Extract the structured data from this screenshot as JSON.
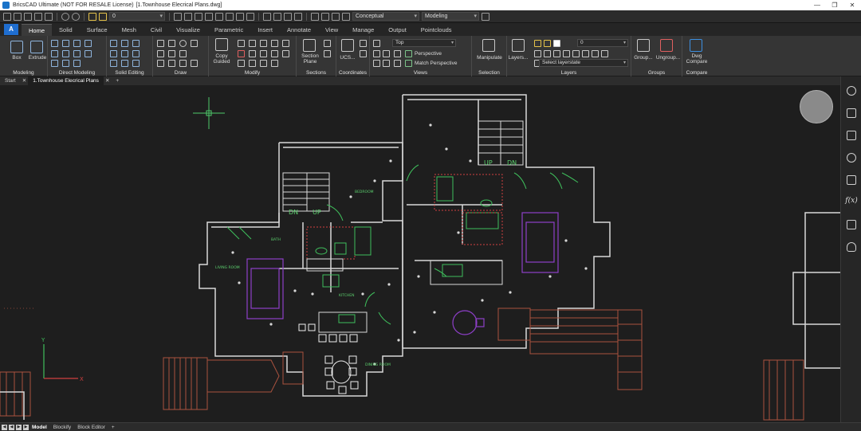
{
  "titlebar": {
    "app": "BricsCAD Ultimate (NOT FOR RESALE License)",
    "doc": "[1.Townhouse Elecrical Plans.dwg]",
    "minimize": "—",
    "restore": "❐",
    "close": "✕"
  },
  "qat": {
    "layer_value": "0",
    "visual_style": "Conceptual",
    "workspace": "Modeling"
  },
  "app_button": "A",
  "tabs": [
    "Home",
    "Solid",
    "Surface",
    "Mesh",
    "Civil",
    "Visualize",
    "Parametric",
    "Insert",
    "Annotate",
    "View",
    "Manage",
    "Output",
    "Pointclouds"
  ],
  "ribbon": {
    "box": "Box",
    "extrude": "Extrude",
    "copy_guided": "Copy Guided",
    "section_plane": "Section Plane",
    "ucs": "UCS...",
    "view_top": "Top",
    "perspective": "Perspective",
    "match_perspective": "Match Perspective",
    "manipulate": "Manipulate",
    "layers": "Layers...",
    "layer_current": "0",
    "layerstate": "Select layerstate",
    "group": "Group...",
    "ungroup": "Ungroup...",
    "dwg_compare": "Dwg Compare",
    "panels": {
      "modeling": "Modeling",
      "direct_modeling": "Direct Modeling",
      "solid_editing": "Solid Editing",
      "draw": "Draw",
      "modify": "Modify",
      "sections": "Sections",
      "coordinates": "Coordinates",
      "views": "Views",
      "selection": "Selection",
      "layers": "Layers",
      "groups": "Groups",
      "compare": "Compare"
    }
  },
  "doc_tabs": {
    "start": "Start",
    "close1": "✕",
    "active": "1.Townhouse Elecrical Plans",
    "close2": "✕",
    "add": "+"
  },
  "drawing": {
    "rooms": {
      "bedroom": "BEDROOM",
      "family_room": "LIVING ROOM",
      "kitchen": "KITCHEN",
      "dining": "DINING ROOM",
      "bath": "BATH"
    },
    "dn1": "DN",
    "up1": "UP",
    "dn2": "DN",
    "up2": "UP",
    "axis_y": "Y",
    "axis_x": "X"
  },
  "status": {
    "model": "Model",
    "blockify": "Blockify",
    "block_editor": "Block Editor",
    "add": "+"
  },
  "right_panel": {
    "fx": "f(x)"
  }
}
